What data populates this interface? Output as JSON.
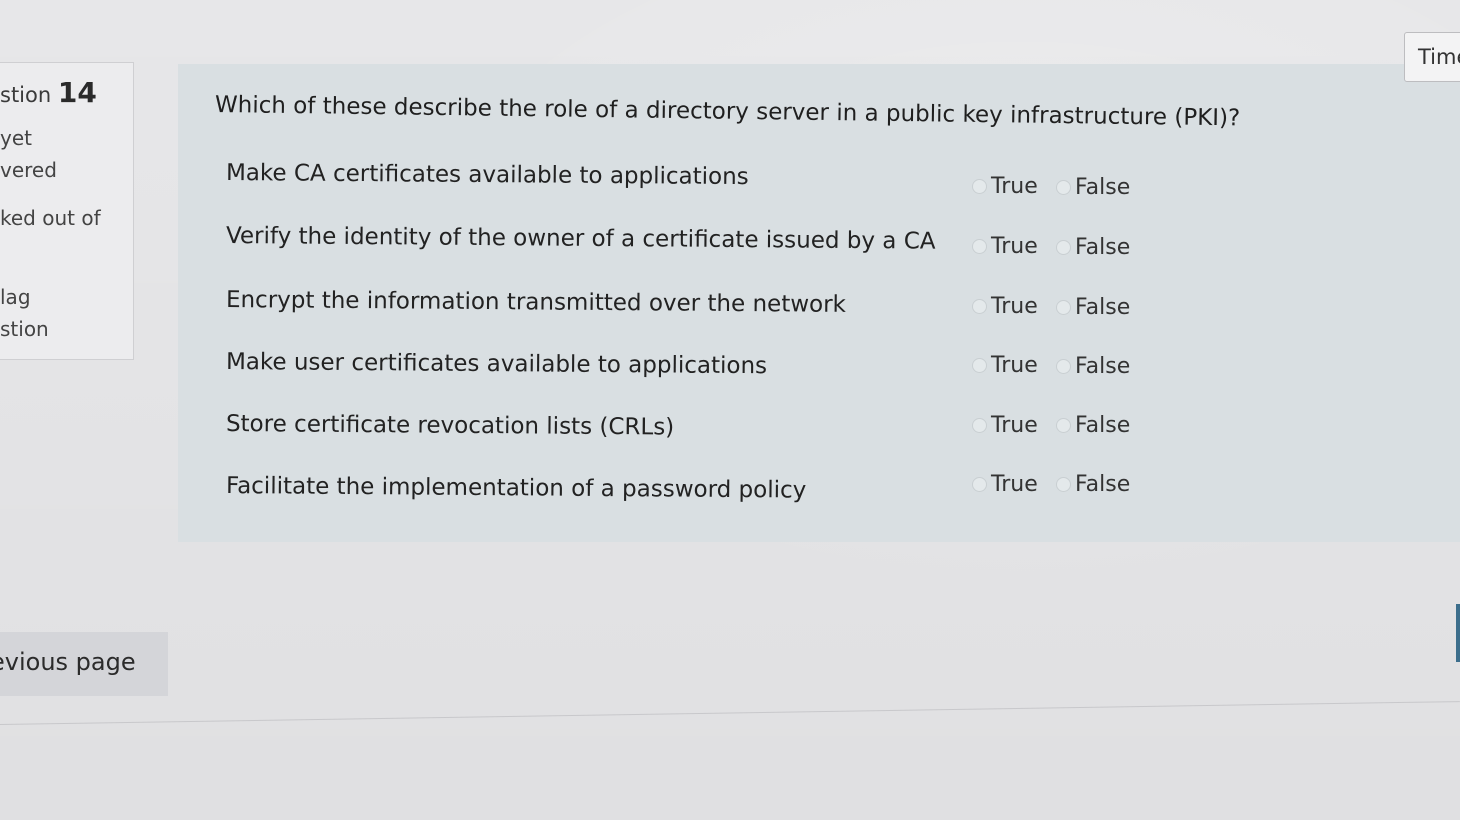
{
  "sidebar": {
    "question_prefix": "stion",
    "question_number": "14",
    "status_line1": "yet",
    "status_line2": "vered",
    "marked_line": "ked out of",
    "flag_line1": "lag",
    "flag_line2": "stion"
  },
  "question": {
    "text": "Which of these describe the role of a directory server in a public key infrastructure (PKI)?",
    "true_label": "True",
    "false_label": "False",
    "statements": [
      "Make CA certificates available to applications",
      "Verify the identity of the owner of a certificate issued by a CA",
      "Encrypt the information transmitted over the network",
      "Make user certificates available to applications",
      "Store certificate revocation lists (CRLs)",
      "Facilitate the implementation of a password policy"
    ]
  },
  "navigation": {
    "previous_label": "evious page"
  },
  "timer": {
    "label": "Time"
  }
}
